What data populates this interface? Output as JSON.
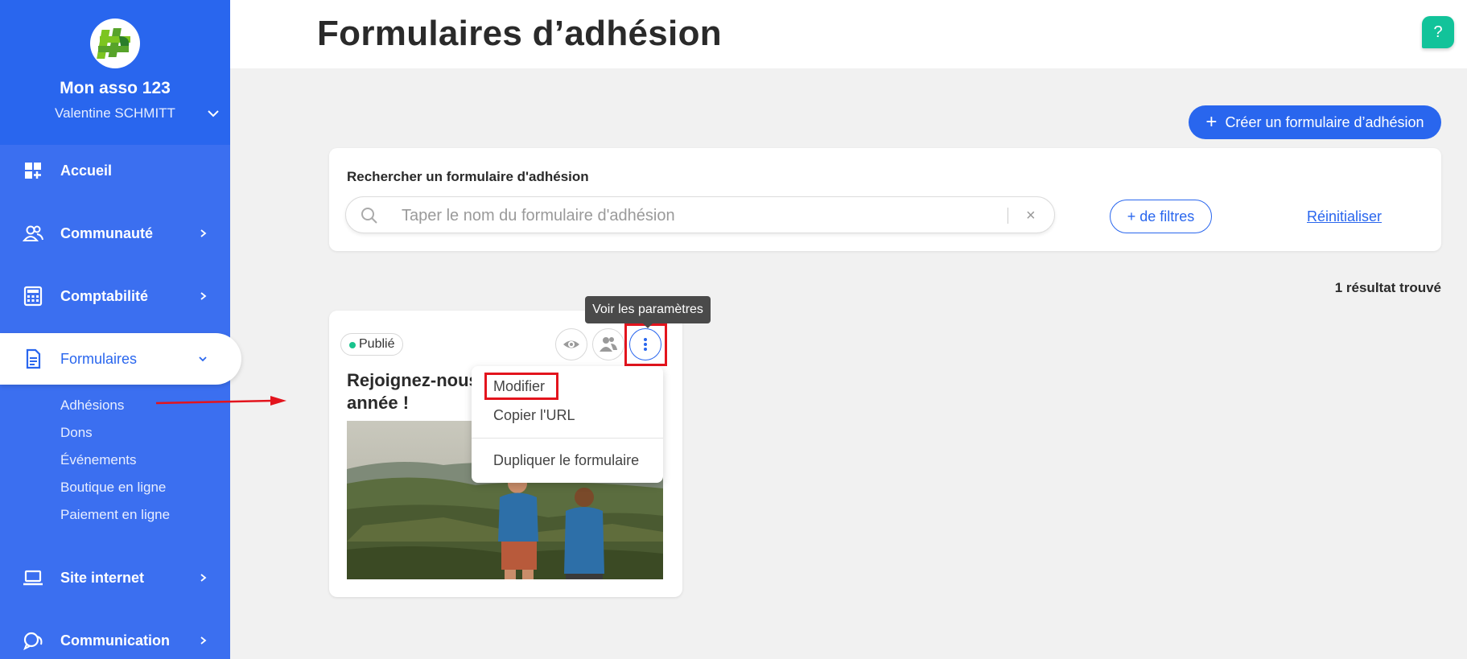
{
  "sidebar": {
    "org_name": "Mon asso 123",
    "user_name": "Valentine SCHMITT",
    "nav": [
      {
        "label": "Accueil",
        "icon": "dashboard-icon"
      },
      {
        "label": "Communauté",
        "icon": "users-icon"
      },
      {
        "label": "Comptabilité",
        "icon": "calculator-icon"
      },
      {
        "label": "Formulaires",
        "icon": "document-icon"
      },
      {
        "label": "Site internet",
        "icon": "laptop-icon"
      },
      {
        "label": "Communication",
        "icon": "chat-icon"
      }
    ],
    "sub_items": [
      "Adhésions",
      "Dons",
      "Événements",
      "Boutique en ligne",
      "Paiement en ligne"
    ]
  },
  "header": {
    "title": "Formulaires d’adhésion",
    "help": "?"
  },
  "actions": {
    "create_label": "Créer un formulaire d’adhésion",
    "create_plus": "+"
  },
  "search": {
    "label": "Rechercher un formulaire d'adhésion",
    "placeholder": "Taper le nom du formulaire d'adhésion",
    "clear": "×",
    "filters_label": "+ de filtres",
    "reset_label": "Réinitialiser"
  },
  "results": {
    "text": "1 résultat trouvé"
  },
  "card": {
    "status": "Publié",
    "title": "Rejoignez-nous année !",
    "title_line1": "Rejoignez-nous",
    "title_line2": "année !"
  },
  "tooltip": {
    "text": "Voir les paramètres"
  },
  "menu": {
    "items": [
      "Modifier",
      "Copier l'URL",
      "Dupliquer le formulaire"
    ]
  },
  "colors": {
    "primary": "#2966ee",
    "sidebar": "#3b6ff0",
    "accent_green": "#12c39a",
    "highlight_red": "#e3141d"
  }
}
